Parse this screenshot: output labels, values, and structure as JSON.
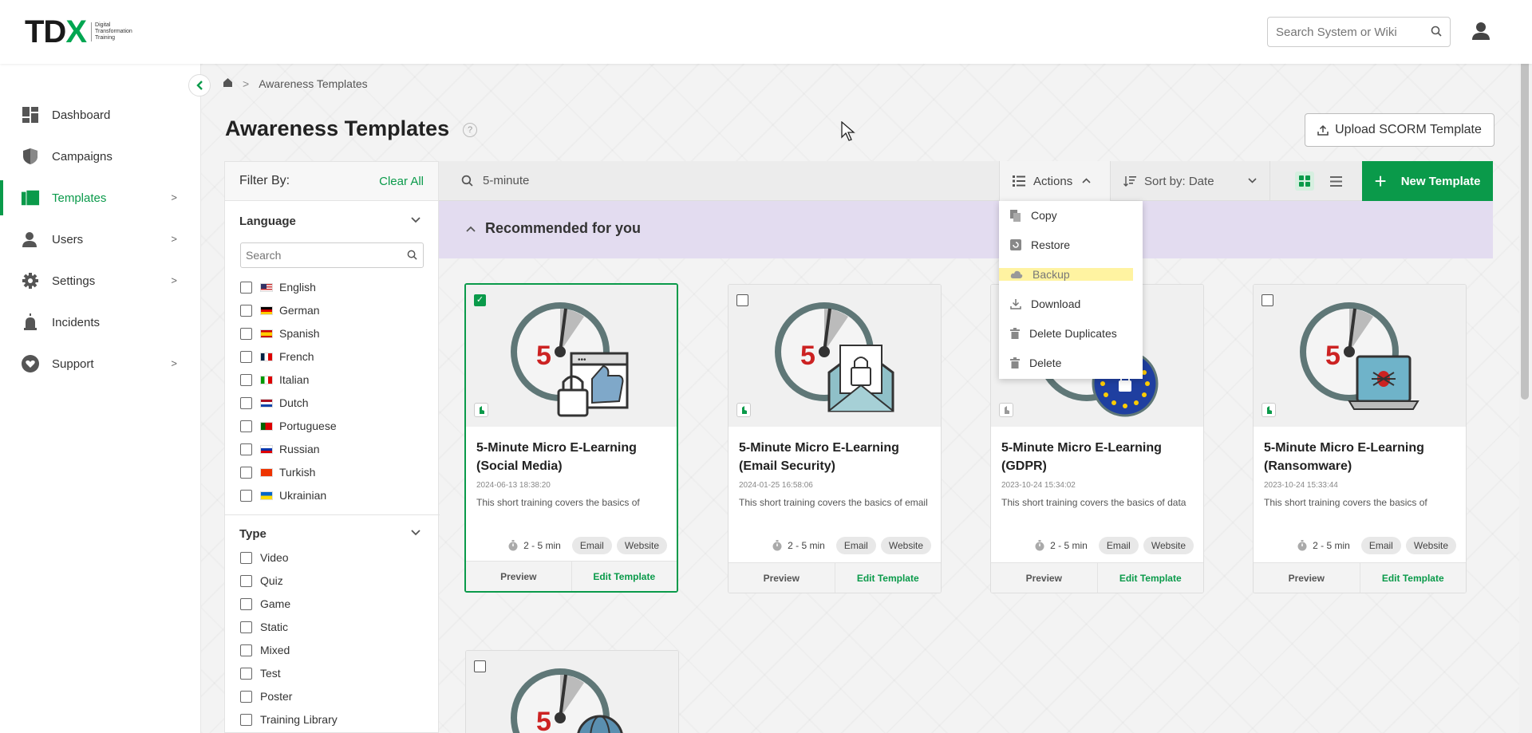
{
  "header": {
    "logo_text": "TDX",
    "logo_sub": "Digital Transformation Training",
    "search_placeholder": "Search System or Wiki"
  },
  "sidebar": {
    "items": [
      {
        "label": "Dashboard",
        "icon": "dashboard-icon",
        "active": false,
        "has_children": false
      },
      {
        "label": "Campaigns",
        "icon": "shield-icon",
        "active": false,
        "has_children": false
      },
      {
        "label": "Templates",
        "icon": "templates-icon",
        "active": true,
        "has_children": true
      },
      {
        "label": "Users",
        "icon": "users-icon",
        "active": false,
        "has_children": true
      },
      {
        "label": "Settings",
        "icon": "gear-icon",
        "active": false,
        "has_children": true
      },
      {
        "label": "Incidents",
        "icon": "alarm-icon",
        "active": false,
        "has_children": false
      },
      {
        "label": "Support",
        "icon": "heart-icon",
        "active": false,
        "has_children": true
      }
    ],
    "chev": ">"
  },
  "breadcrumb": {
    "sep": ">",
    "current": "Awareness Templates"
  },
  "page": {
    "title": "Awareness Templates",
    "help": "?",
    "upload_label": "Upload SCORM Template"
  },
  "filter": {
    "title": "Filter By:",
    "clear": "Clear All",
    "language": {
      "title": "Language",
      "search_placeholder": "Search",
      "options": [
        "English",
        "German",
        "Spanish",
        "French",
        "Italian",
        "Dutch",
        "Portuguese",
        "Russian",
        "Turkish",
        "Ukrainian"
      ]
    },
    "type": {
      "title": "Type",
      "options": [
        "Video",
        "Quiz",
        "Game",
        "Static",
        "Mixed",
        "Test",
        "Poster",
        "Training Library"
      ]
    }
  },
  "toolbar": {
    "search_value": "5-minute",
    "actions_label": "Actions",
    "sort_label": "Sort by: Date",
    "new_label": "New Template"
  },
  "actions_menu": {
    "items": [
      "Copy",
      "Restore",
      "Backup",
      "Download",
      "Delete Duplicates",
      "Delete"
    ],
    "highlighted": "Backup"
  },
  "recommended": {
    "title": "Recommended for you"
  },
  "cards": [
    {
      "title": "5-Minute Micro E-Learning (Social Media)",
      "date": "2024-06-13 18:38:20",
      "desc": "This short training covers the basics of",
      "duration": "2 - 5 min",
      "tags": [
        "Email",
        "Website"
      ],
      "selected": true,
      "preview": "Preview",
      "edit": "Edit Template"
    },
    {
      "title": "5-Minute Micro E-Learning (Email Security)",
      "date": "2024-01-25 16:58:06",
      "desc": "This short training covers the basics of email",
      "duration": "2 - 5 min",
      "tags": [
        "Email",
        "Website"
      ],
      "selected": false,
      "preview": "Preview",
      "edit": "Edit Template"
    },
    {
      "title": "5-Minute Micro E-Learning (GDPR)",
      "date": "2023-10-24 15:34:02",
      "desc": "This short training covers the basics of data",
      "duration": "2 - 5 min",
      "tags": [
        "Email",
        "Website"
      ],
      "selected": false,
      "preview": "Preview",
      "edit": "Edit Template"
    },
    {
      "title": "5-Minute Micro E-Learning (Ransomware)",
      "date": "2023-10-24 15:33:44",
      "desc": "This short training covers the basics of",
      "duration": "2 - 5 min",
      "tags": [
        "Email",
        "Website"
      ],
      "selected": false,
      "preview": "Preview",
      "edit": "Edit Template"
    }
  ],
  "colors": {
    "accent": "#0a9a4a",
    "recommended_bg": "#e3dcf0",
    "highlight": "#fff08a"
  }
}
